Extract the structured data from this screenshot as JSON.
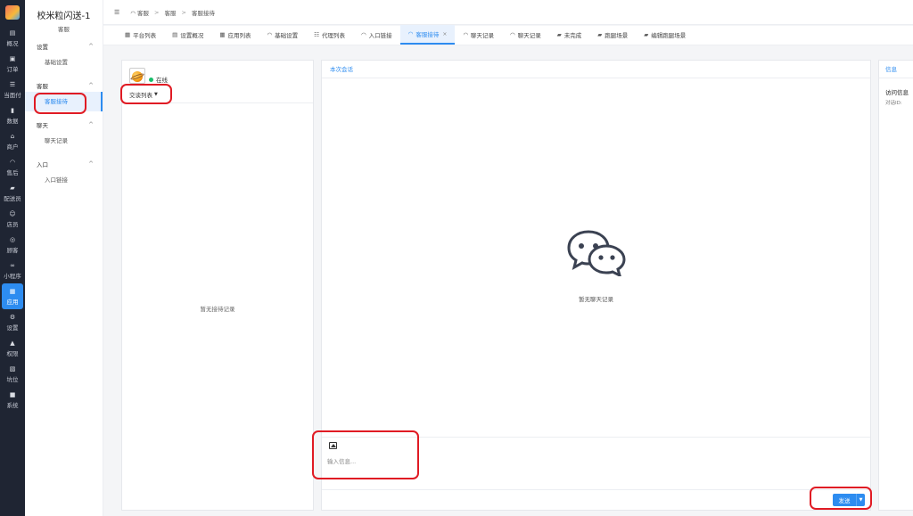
{
  "rail": {
    "items": [
      {
        "label": "概况",
        "icon": "overview-icon",
        "glyph": "▤"
      },
      {
        "label": "订单",
        "icon": "order-icon",
        "glyph": "▣"
      },
      {
        "label": "当面付",
        "icon": "pay-icon",
        "glyph": "☰"
      },
      {
        "label": "数据",
        "icon": "data-icon",
        "glyph": "▮"
      },
      {
        "label": "商户",
        "icon": "merchant-icon",
        "glyph": "⌂"
      },
      {
        "label": "售后",
        "icon": "aftersale-icon",
        "glyph": "◠"
      },
      {
        "label": "配送员",
        "icon": "courier-icon",
        "glyph": "▰"
      },
      {
        "label": "店员",
        "icon": "staff-icon",
        "glyph": "☺"
      },
      {
        "label": "顾客",
        "icon": "customer-icon",
        "glyph": "◎"
      },
      {
        "label": "小程序",
        "icon": "miniapp-icon",
        "glyph": "∞"
      },
      {
        "label": "应用",
        "icon": "apps-icon",
        "glyph": "▦"
      },
      {
        "label": "设置",
        "icon": "settings-icon",
        "glyph": "⚙"
      },
      {
        "label": "权限",
        "icon": "permission-icon",
        "glyph": "▲"
      },
      {
        "label": "坑位",
        "icon": "slot-icon",
        "glyph": "▧"
      },
      {
        "label": "系统",
        "icon": "system-icon",
        "glyph": "■"
      }
    ]
  },
  "subnav": {
    "title": "校米粒闪送-1",
    "subtitle": "客服",
    "groups": [
      {
        "label": "设置",
        "items": [
          "基础设置"
        ]
      },
      {
        "label": "客服",
        "items": [
          "客服接待"
        ]
      },
      {
        "label": "聊天",
        "items": [
          "聊天记录"
        ]
      },
      {
        "label": "入口",
        "items": [
          "入口链接"
        ]
      }
    ]
  },
  "breadcrumb": [
    "客服",
    "客服",
    "客服接待"
  ],
  "breadcrumb_sep": ">",
  "tabs": [
    {
      "label": "平台列表",
      "icon": "grid-icon",
      "glyph": "▦"
    },
    {
      "label": "设置概况",
      "icon": "grid-icon",
      "glyph": "▤"
    },
    {
      "label": "应用列表",
      "icon": "grid-icon",
      "glyph": "▦"
    },
    {
      "label": "基础设置",
      "icon": "headset-icon",
      "glyph": "◠"
    },
    {
      "label": "代理列表",
      "icon": "users-icon",
      "glyph": "☷"
    },
    {
      "label": "入口链接",
      "icon": "headset-icon",
      "glyph": "◠"
    },
    {
      "label": "客服接待",
      "icon": "headset-icon",
      "glyph": "◠",
      "active": true,
      "close": "×"
    },
    {
      "label": "聊天记录",
      "icon": "headset-icon",
      "glyph": "◠"
    },
    {
      "label": "聊天记录",
      "icon": "headset-icon",
      "glyph": "◠"
    },
    {
      "label": "未完成",
      "icon": "truck-icon",
      "glyph": "▰"
    },
    {
      "label": "跑腿场景",
      "icon": "truck-icon",
      "glyph": "▰"
    },
    {
      "label": "编辑跑腿场景",
      "icon": "truck-icon",
      "glyph": "▰"
    }
  ],
  "left": {
    "status": "在线",
    "list_toggle": "交谈列表",
    "empty": "暂无接待记录"
  },
  "chat": {
    "header": "本次会话",
    "empty": "暂无聊天记录",
    "input_placeholder": "输入信息...",
    "send": "发送"
  },
  "info": {
    "header": "信息",
    "label": "访问信息",
    "sub": "对话ID:"
  },
  "colors": {
    "accent": "#2d8cf0",
    "rail_bg": "#1f2533",
    "online": "#19be6b",
    "highlight": "#e01b24"
  }
}
